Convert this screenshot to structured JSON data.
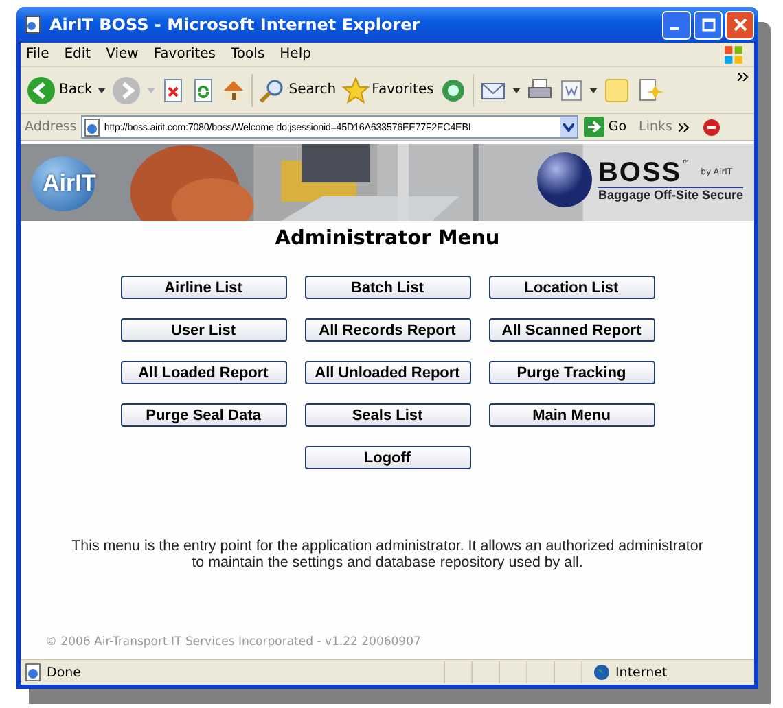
{
  "window": {
    "title": "AirIT BOSS - Microsoft Internet Explorer"
  },
  "menu": [
    "File",
    "Edit",
    "View",
    "Favorites",
    "Tools",
    "Help"
  ],
  "toolbar": {
    "back": "Back",
    "search": "Search",
    "favorites": "Favorites"
  },
  "address": {
    "label": "Address",
    "url": "http://boss.airit.com:7080/boss/Welcome.do;jsessionid=45D16A633576EE77F2EC4EBI",
    "go": "Go",
    "links": "Links"
  },
  "banner": {
    "left_logo": "AirIT",
    "right_logo": "BOSS",
    "trademark": "™",
    "byline": "by AirIT",
    "tagline": "Baggage Off-Site Secure"
  },
  "heading": "Administrator Menu",
  "buttons": [
    "Airline List",
    "Batch List",
    "Location List",
    "User List",
    "All Records Report",
    "All Scanned Report",
    "All Loaded Report",
    "All Unloaded Report",
    "Purge Tracking",
    "Purge Seal Data",
    "Seals List",
    "Main Menu",
    "Logoff"
  ],
  "description": "This menu is the entry point for the application administrator. It allows an authorized administrator to maintain the settings and database repository used by all.",
  "copyright": "© 2006 Air-Transport IT Services Incorporated - v1.22 20060907",
  "status_bar": {
    "text": "Done",
    "zone": "Internet"
  }
}
